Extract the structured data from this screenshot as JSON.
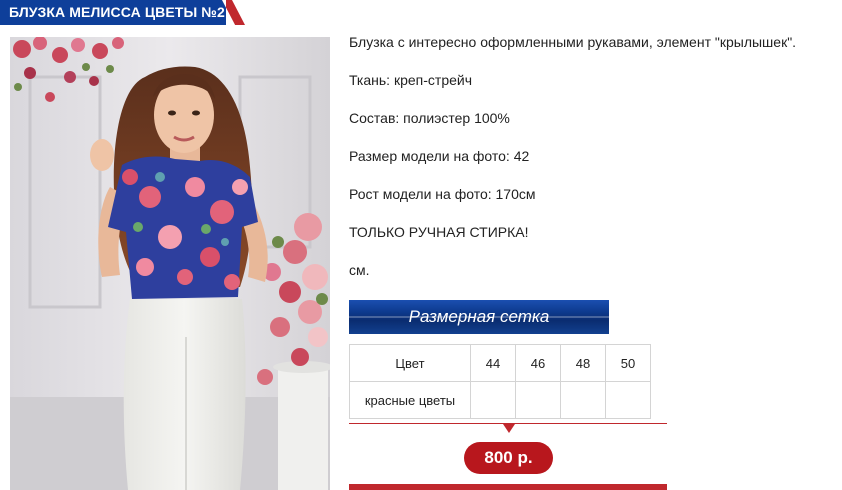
{
  "product": {
    "title": "БЛУЗКА МЕЛИССА ЦВЕТЫ №2",
    "description": [
      "Блузка с интересно оформленными рукавами, элемент \"крылышек\".",
      "Ткань: креп-стрейч",
      "Состав: полиэстер 100%",
      "Размер модели на фото: 42",
      "Рост модели на фото: 170см",
      "ТОЛЬКО РУЧНАЯ СТИРКА!",
      "см."
    ],
    "size_chart_label": "Размерная сетка",
    "price": "800 р."
  },
  "size_table": {
    "header": [
      "Цвет",
      "44",
      "46",
      "48",
      "50"
    ],
    "rows": [
      [
        "красные цветы",
        "",
        "",
        "",
        ""
      ]
    ]
  },
  "colors": {
    "title_blue": "#0e3f9a",
    "accent_red": "#c0282d",
    "price_red": "#b8171d"
  }
}
